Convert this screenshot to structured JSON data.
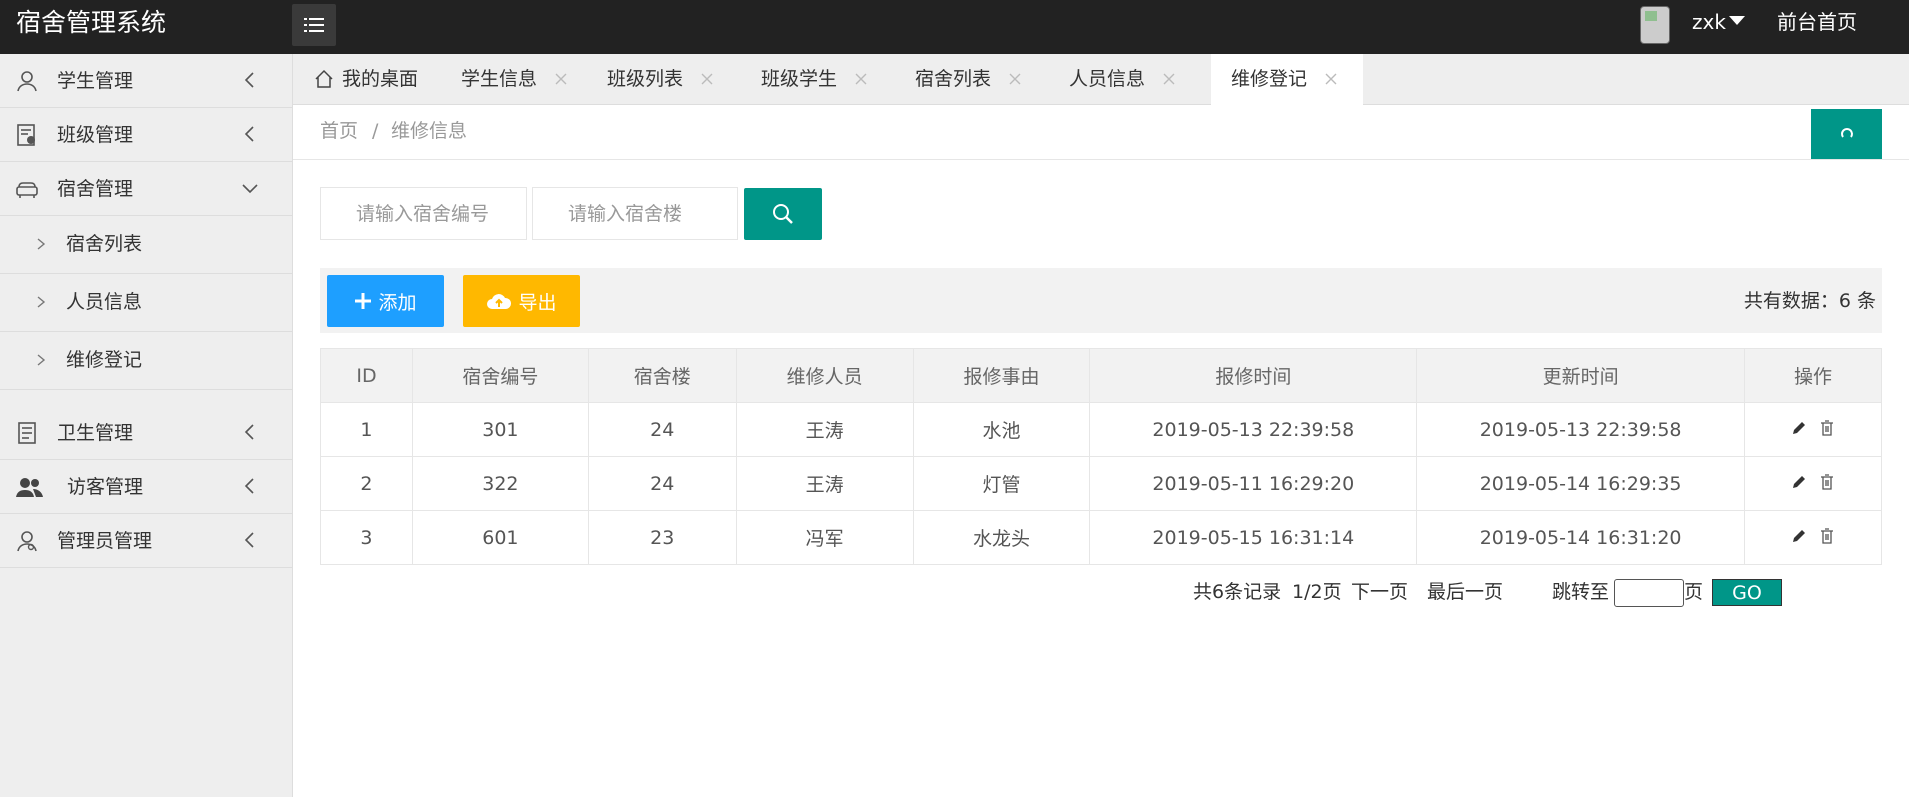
{
  "header": {
    "logo": "宿舍管理系统",
    "username": "zxk",
    "front_link": "前台首页"
  },
  "sidebar": {
    "items": [
      {
        "label": "学生管理",
        "icon": "user-icon",
        "expanded": false
      },
      {
        "label": "班级管理",
        "icon": "class-icon",
        "expanded": false
      },
      {
        "label": "宿舍管理",
        "icon": "sofa-icon",
        "expanded": true
      },
      {
        "label": "卫生管理",
        "icon": "clipboard-icon",
        "expanded": false
      },
      {
        "label": "访客管理",
        "icon": "users-icon",
        "expanded": false
      },
      {
        "label": "管理员管理",
        "icon": "admin-icon",
        "expanded": false
      }
    ],
    "sub_items": [
      {
        "label": "宿舍列表"
      },
      {
        "label": "人员信息"
      },
      {
        "label": "维修登记"
      }
    ]
  },
  "tabs": [
    {
      "label": "我的桌面",
      "icon": "home-icon",
      "closable": false
    },
    {
      "label": "学生信息",
      "closable": true
    },
    {
      "label": "班级列表",
      "closable": true
    },
    {
      "label": "班级学生",
      "closable": true
    },
    {
      "label": "宿舍列表",
      "closable": true
    },
    {
      "label": "人员信息",
      "closable": true
    },
    {
      "label": "维修登记",
      "closable": true,
      "active": true
    }
  ],
  "breadcrumb": {
    "home": "首页",
    "separator": "/",
    "current": "维修信息"
  },
  "search": {
    "room_placeholder": "请输入宿舍编号",
    "building_placeholder": "请输入宿舍楼"
  },
  "toolbar": {
    "add_label": "添加",
    "export_label": "导出",
    "total_text": "共有数据：6 条"
  },
  "table": {
    "columns": [
      "ID",
      "宿舍编号",
      "宿舍楼",
      "维修人员",
      "报修事由",
      "报修时间",
      "更新时间",
      "操作"
    ],
    "rows": [
      [
        "1",
        "301",
        "24",
        "王涛",
        "水池",
        "2019-05-13 22:39:58",
        "2019-05-13 22:39:58"
      ],
      [
        "2",
        "322",
        "24",
        "王涛",
        "灯管",
        "2019-05-11 16:29:20",
        "2019-05-14 16:29:35"
      ],
      [
        "3",
        "601",
        "23",
        "冯军",
        "水龙头",
        "2019-05-15 16:31:14",
        "2019-05-14 16:31:20"
      ]
    ]
  },
  "pager": {
    "records": "共6条记录",
    "page": "1/2页",
    "next": "下一页",
    "last": "最后一页",
    "jump_label": "跳转至",
    "page_suffix": "页",
    "go": "GO"
  },
  "colors": {
    "header_bg": "#222222",
    "primary": "#009688",
    "add_btn": "#1e9fff",
    "export_btn": "#ffb800",
    "sidebar_bg": "#eeeeee"
  }
}
